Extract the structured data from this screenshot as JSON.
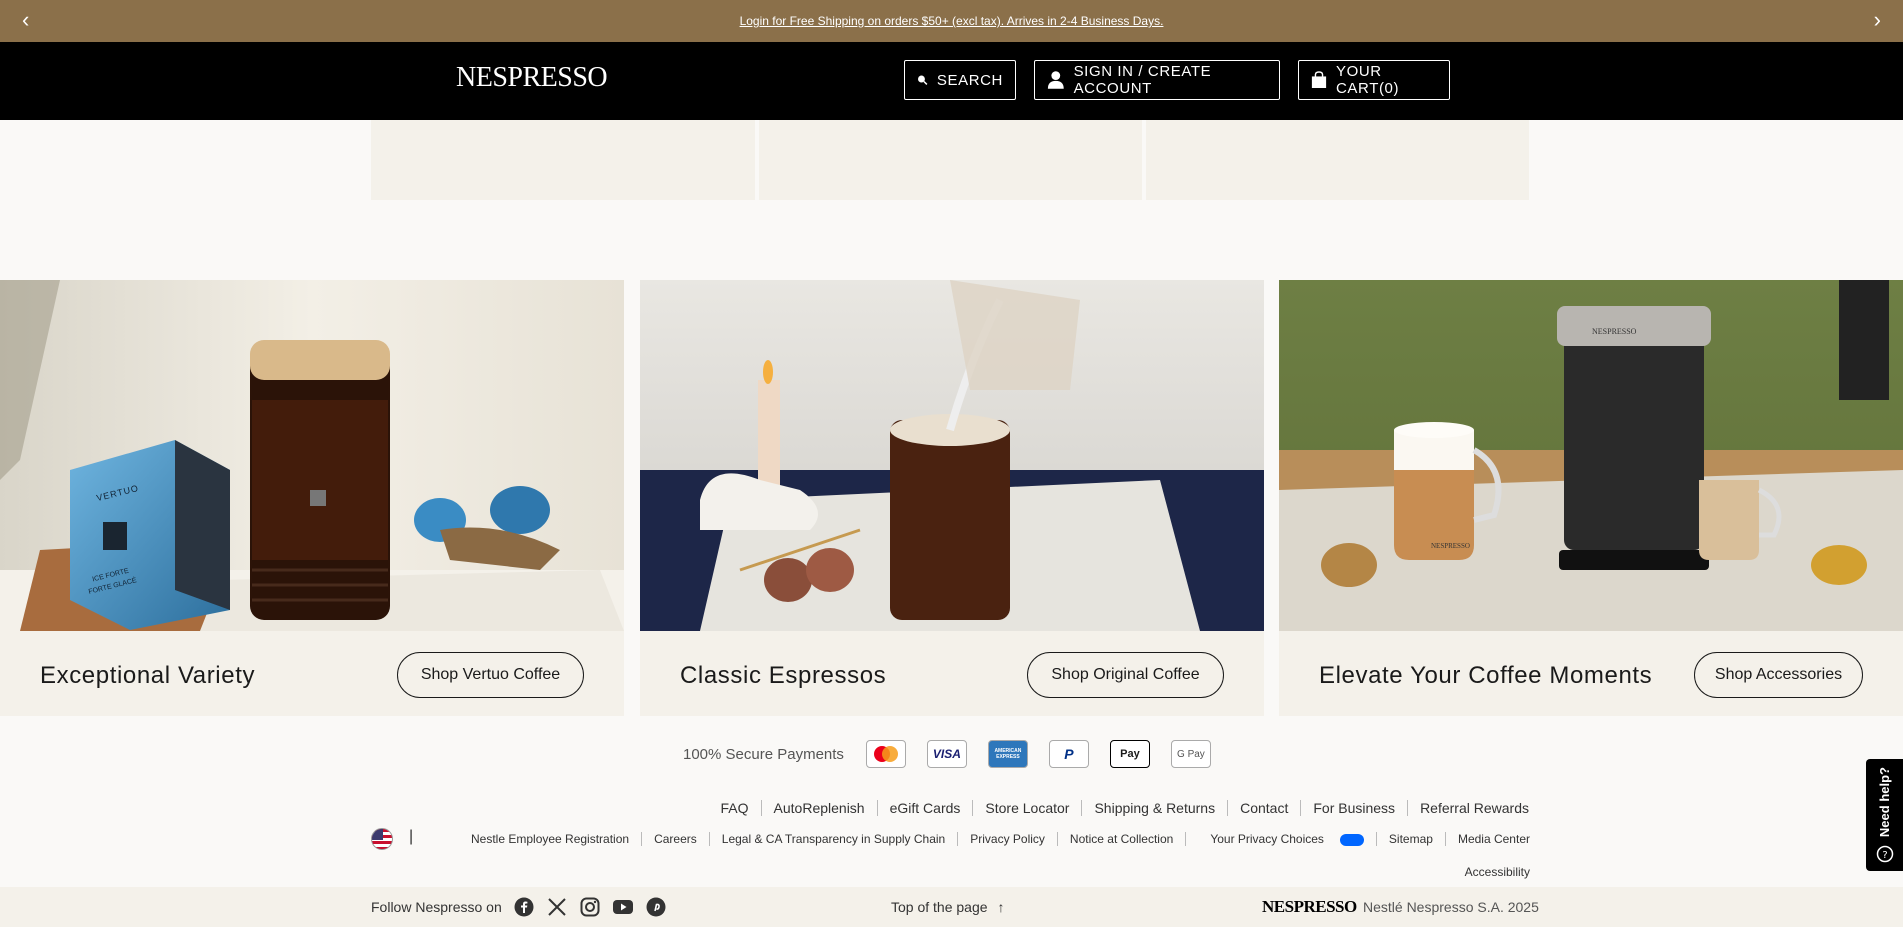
{
  "promo": {
    "text": "Login for Free Shipping on orders $50+ (excl tax). Arrives in 2-4 Business Days.",
    "prev": "‹",
    "next": "›"
  },
  "header": {
    "logo": "NESPRESSO",
    "search_label": "SEARCH",
    "signin_label": "SIGN IN / CREATE ACCOUNT",
    "cart_label": "YOUR CART(0)"
  },
  "cards": [
    {
      "title": "Exceptional Variety",
      "cta": "Shop Vertuo Coffee",
      "box_brand": "VERTUO",
      "box_text1": "ICE FORTE",
      "box_text2": "FORTE GLACÉ"
    },
    {
      "title": "Classic Espressos",
      "cta": "Shop Original Coffee"
    },
    {
      "title": "Elevate Your Coffee Moments",
      "cta": "Shop Accessories",
      "machine_brand": "NESPRESSO",
      "mug_brand": "NESPRESSO"
    }
  ],
  "payments": {
    "label": "100% Secure Payments",
    "methods": [
      "VISA",
      "AMERICAN EXPRESS",
      "P",
      "Pay",
      "G Pay"
    ]
  },
  "footer": {
    "links_primary": [
      "FAQ",
      "AutoReplenish",
      "eGift Cards",
      "Store Locator",
      "Shipping & Returns",
      "Contact",
      "For Business",
      "Referral Rewards"
    ],
    "links_secondary": [
      "Nestle Employee Registration",
      "Careers",
      "Legal & CA Transparency in Supply Chain",
      "Privacy Policy",
      "Notice at Collection",
      "Your Privacy Choices",
      "Sitemap",
      "Media Center"
    ],
    "accessibility": "Accessibility",
    "flag_separator": "|",
    "follow": "Follow Nespresso on",
    "top_of_page": "Top of the page",
    "top_arrow": "↑",
    "logo": "NESPRESSO",
    "copyright": "Nestlé Nespresso S.A. 2025"
  },
  "help": {
    "label": "Need help?"
  }
}
